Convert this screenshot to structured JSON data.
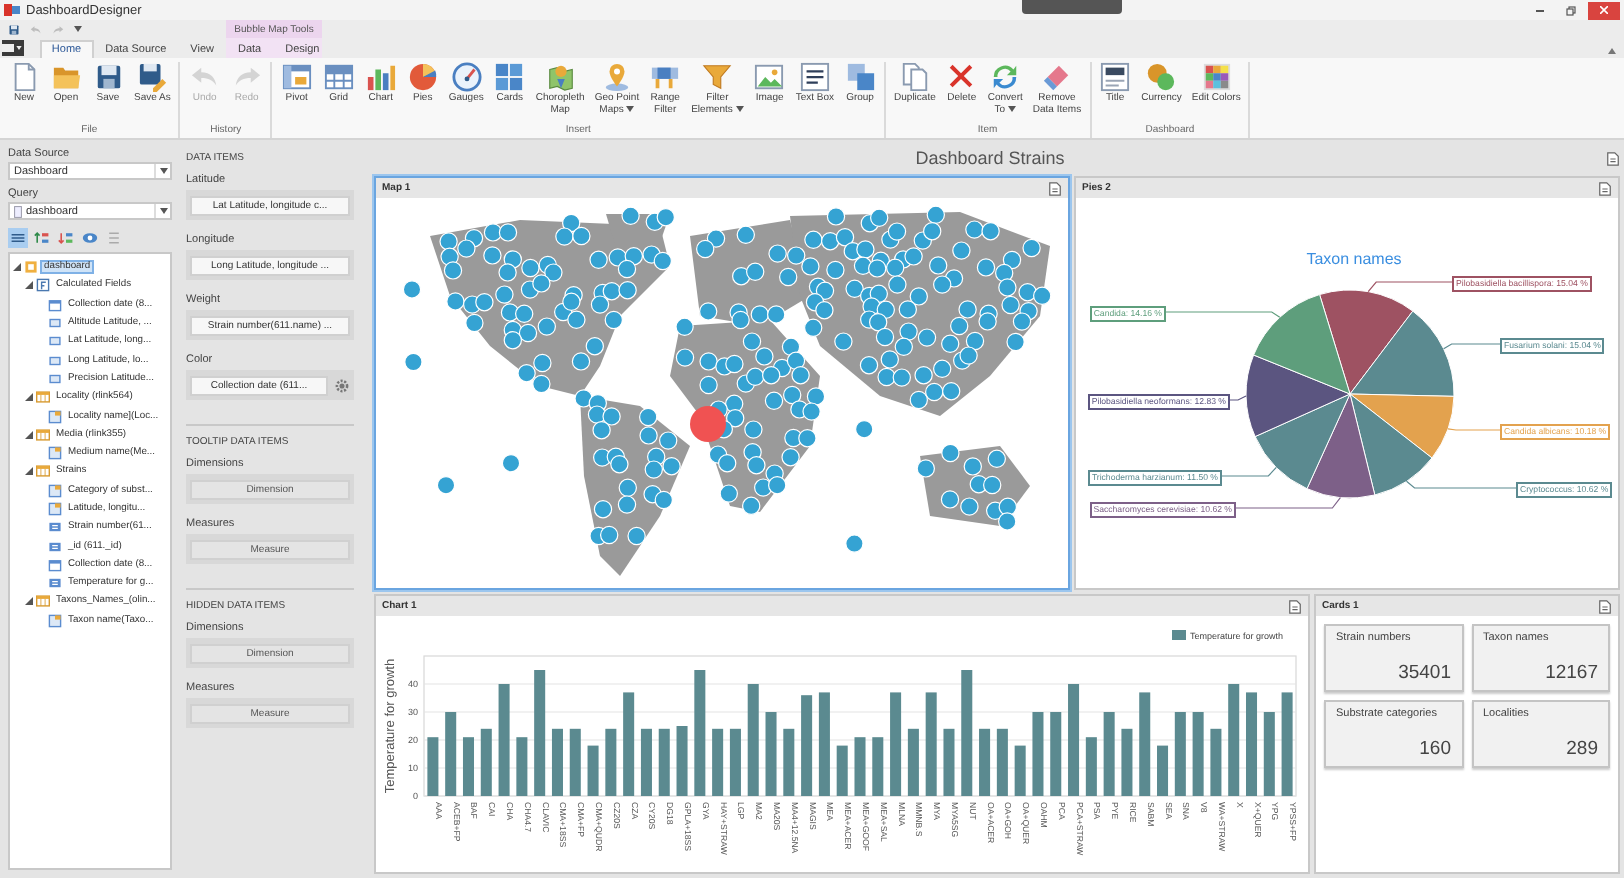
{
  "window": {
    "title": "DashboardDesigner"
  },
  "ribbon": {
    "tabs": [
      {
        "label": "Home",
        "selected": true
      },
      {
        "label": "Data Source",
        "selected": false
      },
      {
        "label": "View",
        "selected": false
      }
    ],
    "context_group": {
      "title": "Bubble Map Tools",
      "tabs": [
        {
          "label": "Data",
          "selected": false
        },
        {
          "label": "Design",
          "selected": false
        }
      ]
    },
    "groups": [
      {
        "label": "File",
        "buttons": [
          {
            "label": "New",
            "disabled": false,
            "dropdown": false
          },
          {
            "label": "Open",
            "disabled": false,
            "dropdown": false
          },
          {
            "label": "Save",
            "disabled": false,
            "dropdown": false
          },
          {
            "label": "Save As",
            "disabled": false,
            "dropdown": false
          }
        ]
      },
      {
        "label": "History",
        "buttons": [
          {
            "label": "Undo",
            "disabled": true,
            "dropdown": false
          },
          {
            "label": "Redo",
            "disabled": true,
            "dropdown": false
          }
        ]
      },
      {
        "label": "Insert",
        "buttons": [
          {
            "label": "Pivot",
            "disabled": false,
            "dropdown": false
          },
          {
            "label": "Grid",
            "disabled": false,
            "dropdown": false
          },
          {
            "label": "Chart",
            "disabled": false,
            "dropdown": false
          },
          {
            "label": "Pies",
            "disabled": false,
            "dropdown": false
          },
          {
            "label": "Gauges",
            "disabled": false,
            "dropdown": false
          },
          {
            "label": "Cards",
            "disabled": false,
            "dropdown": false
          },
          {
            "label": "Choropleth\nMap",
            "disabled": false,
            "dropdown": false
          },
          {
            "label": "Geo Point\nMaps",
            "disabled": false,
            "dropdown": true
          },
          {
            "label": "Range\nFilter",
            "disabled": false,
            "dropdown": false
          },
          {
            "label": "Filter\nElements",
            "disabled": false,
            "dropdown": true
          },
          {
            "label": "Image",
            "disabled": false,
            "dropdown": false
          },
          {
            "label": "Text Box",
            "disabled": false,
            "dropdown": false
          },
          {
            "label": "Group",
            "disabled": false,
            "dropdown": false
          }
        ]
      },
      {
        "label": "Item",
        "buttons": [
          {
            "label": "Duplicate",
            "disabled": false,
            "dropdown": false
          },
          {
            "label": "Delete",
            "disabled": false,
            "dropdown": false
          },
          {
            "label": "Convert\nTo",
            "disabled": false,
            "dropdown": true
          },
          {
            "label": "Remove\nData Items",
            "disabled": false,
            "dropdown": false
          }
        ]
      },
      {
        "label": "Dashboard",
        "buttons": [
          {
            "label": "Title",
            "disabled": false,
            "dropdown": false
          },
          {
            "label": "Currency",
            "disabled": false,
            "dropdown": false
          },
          {
            "label": "Edit Colors",
            "disabled": false,
            "dropdown": false
          }
        ]
      }
    ]
  },
  "data_source": {
    "label": "Data Source",
    "value": "Dashboard"
  },
  "query": {
    "label": "Query",
    "value": "dashboard"
  },
  "tools": [
    {
      "selected": true
    },
    {
      "selected": false
    },
    {
      "selected": false
    },
    {
      "selected": false
    },
    {
      "selected": false
    }
  ],
  "tree": [
    {
      "label": "dashboard",
      "kind": "source",
      "expanded": true,
      "selected": true,
      "children": [
        {
          "label": "Calculated Fields",
          "kind": "calc-group",
          "expanded": true,
          "selected": false,
          "children": [
            {
              "label": "Collection date (8...",
              "kind": "date-field",
              "selected": false
            },
            {
              "label": "Altitude Latitude, ...",
              "kind": "calc-field",
              "selected": false
            },
            {
              "label": "Lat Latitude, long...",
              "kind": "calc-field",
              "selected": false
            },
            {
              "label": "Long Latitude, lo...",
              "kind": "calc-field",
              "selected": false
            },
            {
              "label": "Precision Latitude...",
              "kind": "calc-field",
              "selected": false
            }
          ]
        },
        {
          "label": "Locality (rlink564)",
          "kind": "table",
          "expanded": true,
          "selected": false,
          "children": [
            {
              "label": "Locality name](Loc...",
              "kind": "text-field",
              "selected": false
            }
          ]
        },
        {
          "label": "Media (rlink355)",
          "kind": "table",
          "expanded": true,
          "selected": false,
          "children": [
            {
              "label": "Medium name(Me...",
              "kind": "text-field",
              "selected": false
            }
          ]
        },
        {
          "label": "Strains",
          "kind": "table",
          "expanded": true,
          "selected": false,
          "children": [
            {
              "label": "Category of subst...",
              "kind": "text-field",
              "selected": false
            },
            {
              "label": "Latitude, longitu...",
              "kind": "text-field",
              "selected": false
            },
            {
              "label": "Strain number(61...",
              "kind": "number-field",
              "selected": false
            },
            {
              "label": "_id (611._id)",
              "kind": "number-field",
              "selected": false
            },
            {
              "label": "Collection date (8...",
              "kind": "date-field",
              "selected": false
            },
            {
              "label": "Temperature for g...",
              "kind": "number-field",
              "selected": false
            }
          ]
        },
        {
          "label": "Taxons_Names_(olin...",
          "kind": "table",
          "expanded": true,
          "selected": false,
          "children": [
            {
              "label": "Taxon name(Taxo...",
              "kind": "text-field",
              "selected": false
            }
          ]
        }
      ]
    }
  ],
  "data_items": {
    "sections": [
      {
        "title": "DATA ITEMS",
        "fields": [
          {
            "label": "Latitude",
            "value": "Lat Latitude, longitude c...",
            "kind": "binding"
          },
          {
            "label": "Longitude",
            "value": "Long Latitude, longitude ...",
            "kind": "binding"
          },
          {
            "label": "Weight",
            "value": "Strain number(611.name) ...",
            "kind": "binding"
          },
          {
            "label": "Color",
            "value": "Collection date (611...",
            "kind": "binding-options"
          }
        ]
      },
      {
        "title": "TOOLTIP DATA ITEMS",
        "fields": [
          {
            "label": "Dimensions",
            "value": "Dimension",
            "kind": "empty"
          },
          {
            "label": "Measures",
            "value": "Measure",
            "kind": "empty"
          }
        ]
      },
      {
        "title": "HIDDEN DATA ITEMS",
        "fields": [
          {
            "label": "Dimensions",
            "value": "Dimension",
            "kind": "empty"
          },
          {
            "label": "Measures",
            "value": "Measure",
            "kind": "empty"
          }
        ]
      }
    ]
  },
  "dashboard": {
    "title": "Dashboard Strains",
    "items": [
      {
        "kind": "map",
        "title": "Map 1",
        "selected": true
      },
      {
        "kind": "pie",
        "title": "Pies 2",
        "selected": false,
        "chart_data": {
          "type": "pie",
          "title": "Taxon names",
          "values": [
            15.04,
            15.04,
            10.18,
            10.62,
            10.62,
            11.5,
            12.83,
            14.16
          ],
          "colors": [
            "#9e5262",
            "#5b8a90",
            "#e3a24e",
            "#5b8a90",
            "#7d6088",
            "#5b8a90",
            "#5b5580",
            "#5e9e7c"
          ],
          "value_labels": [
            "Pilobasidiella bacillispora: 15.04 %",
            "Fusarium solani: 15.04 %",
            "Candida albicans: 10.18 %",
            "Cryptococcus: 10.62 %",
            "Saccharomyces cerevisiae: 10.62 %",
            "Trichoderma harzianum: 11.50 %",
            "Pilobasidiella neoformans: 12.83 %",
            "Candida: 14.16 %"
          ]
        }
      },
      {
        "kind": "chart",
        "title": "Chart 1",
        "selected": false,
        "chart_data": {
          "type": "bar",
          "grid": true,
          "ylabel": "Temperature for growth",
          "ylim": [
            0,
            50
          ],
          "yticks": [
            0,
            10,
            20,
            30,
            40
          ],
          "categories": [
            "AAA",
            "ACEB+FP",
            "BAF",
            "CAI",
            "CHA",
            "CHA4.7",
            "CLAVIC",
            "CMA+18SS",
            "CMA+FP",
            "CMA+QUDR",
            "CZ20S",
            "CZA",
            "CY20S",
            "DG18",
            "GPLA+18SS",
            "GYA",
            "HAY+STRAW",
            "LGP",
            "MA2",
            "MA20S",
            "MA4+12.5NA",
            "MAGIS",
            "MEA",
            "MEA+ACER",
            "MEA+GOOF",
            "MEA+SAL",
            "MLNA",
            "MMNB.S",
            "MYA",
            "MYA5SG",
            "NUT",
            "OA+ACER",
            "OA+GOH",
            "OA+QUER",
            "OAHM",
            "PCA",
            "PCA+STRAW",
            "PSA",
            "PYE",
            "RICE",
            "SABM",
            "SEA",
            "SNA",
            "V8",
            "WA+STRAW",
            "X",
            "X+QUER",
            "YPG",
            "YPSS+FP"
          ],
          "series": [
            {
              "name": "Temperature for growth",
              "color": "#5b8a90",
              "values": [
                21,
                30,
                21,
                24,
                40,
                21,
                45,
                24,
                24,
                18,
                24,
                37,
                24,
                24,
                25,
                45,
                24,
                24,
                40,
                30,
                24,
                36,
                37,
                18,
                21,
                21,
                37,
                24,
                37,
                24,
                45,
                24,
                24,
                18,
                30,
                30,
                40,
                21,
                30,
                24,
                37,
                18,
                30,
                30,
                24,
                40,
                37,
                30,
                37
              ]
            }
          ]
        }
      },
      {
        "kind": "cards",
        "title": "Cards 1",
        "selected": false,
        "cards": [
          {
            "title": "Strain numbers",
            "value": "35401"
          },
          {
            "title": "Taxon names",
            "value": "12167"
          },
          {
            "title": "Substrate categories",
            "value": "160"
          },
          {
            "title": "Localities",
            "value": "289"
          }
        ]
      }
    ]
  }
}
